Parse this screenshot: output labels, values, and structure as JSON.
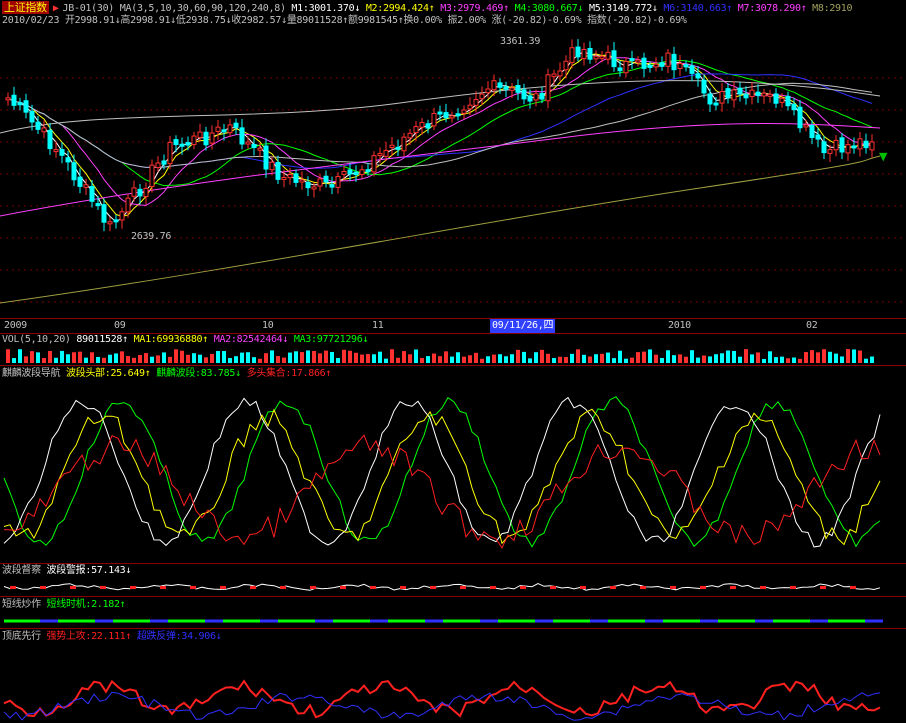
{
  "header": {
    "index_name": "上证指数",
    "indicator": "JB-01(30)",
    "ma_params": "MA(3,5,10,30,60,90,120,240,8)",
    "m1": "M1:3001.370↓",
    "m2": "M2:2994.424↑",
    "m3": "M3:2979.469↑",
    "m4": "M4:3080.667↓",
    "m5": "M5:3149.772↓",
    "m6": "M6:3140.663↑",
    "m7": "M7:3078.290↑",
    "m8": "M8:2910",
    "colors": {
      "m1": "#ffffff",
      "m2": "#ffff00",
      "m3": "#ff40ff",
      "m4": "#00ff00",
      "m5": "#ffffff",
      "m6": "#3030ff",
      "m7": "#ff40ff",
      "m8": "#a0a060"
    }
  },
  "quote": {
    "date": "2010/02/23",
    "open": "开2998.91↓",
    "high": "高2998.91↓",
    "low": "低2938.75↓",
    "close": "收2982.57↓",
    "volume": "量89011528↑",
    "amount": "额9981545↑",
    "turnover": "换0.00%",
    "amplitude": "振2.00%",
    "change": "涨(-20.82)-0.69%",
    "index_change": "指数(-20.82)-0.69%"
  },
  "annotations": {
    "high_label": "3361.39",
    "low_label": "2639.76"
  },
  "time_axis": {
    "labels": [
      "2009",
      "09",
      "10",
      "11",
      "09/11/26,四",
      "2010",
      "02"
    ],
    "highlight_index": 4
  },
  "volume_panel": {
    "name": "VOL(5,10,20)",
    "vol": "89011528↑",
    "ma1": "MA1:69936880↑",
    "ma2": "MA2:82542464↓",
    "ma3": "MA3:97721296↓",
    "colors": {
      "vol": "#ffffff",
      "ma1": "#ffff00",
      "ma2": "#ff40ff",
      "ma3": "#00ff00"
    }
  },
  "panel_wave": {
    "name": "麒麟波段导航",
    "top": "波段头部:25.649↑",
    "wave": "麒麟波段:83.785↓",
    "bull": "多头集合:17.866↑",
    "colors": {
      "top": "#ffff00",
      "wave": "#00ff00",
      "bull": "#ff2020"
    }
  },
  "panel_watch": {
    "name": "波段督察",
    "alert": "波段警报:57.143↓"
  },
  "panel_short": {
    "name": "短线炒作",
    "timing": "短线时机:2.182↑"
  },
  "panel_top": {
    "name": "顶底先行",
    "strong": "强势上攻:22.111↑",
    "rebound": "超跌反弹:34.906↓",
    "colors": {
      "strong": "#ff2020",
      "rebound": "#3030ff"
    }
  }
}
